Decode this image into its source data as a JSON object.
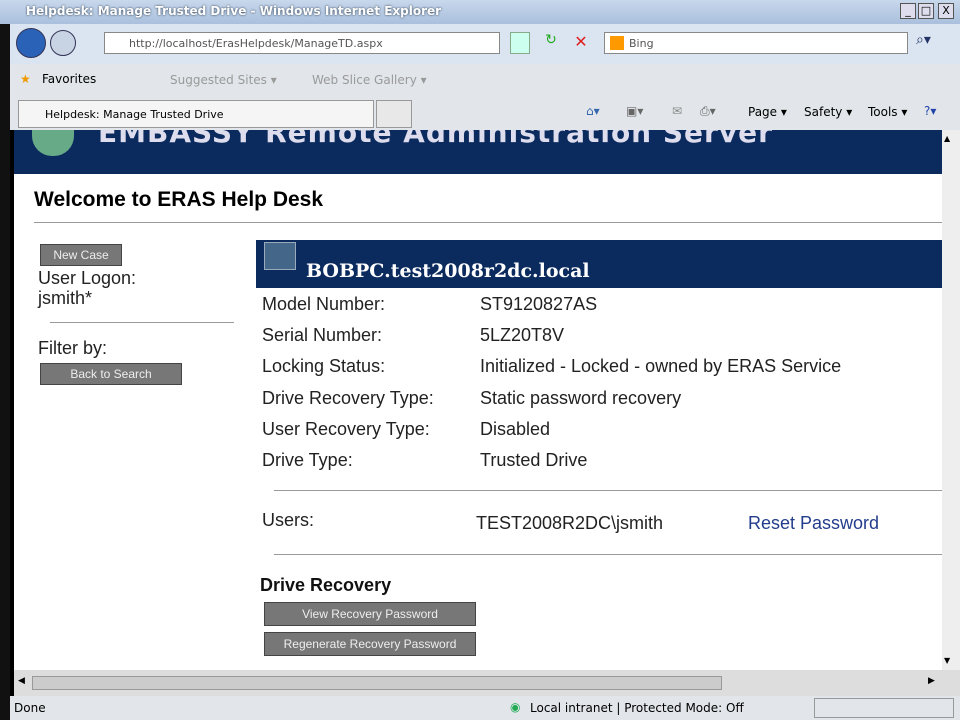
{
  "window": {
    "title": "Helpdesk: Manage Trusted Drive - Windows Internet Explorer",
    "min": "_",
    "max": "□",
    "close": "X"
  },
  "nav": {
    "url": "http://localhost/ErasHelpdesk/ManageTD.aspx",
    "search_placeholder": "Bing"
  },
  "favorites": {
    "label": "Favorites",
    "items": [
      "Suggested Sites ▾",
      "Web Slice Gallery ▾"
    ]
  },
  "tab": {
    "label": "Helpdesk: Manage Trusted Drive"
  },
  "commands": [
    "Page ▾",
    "Safety ▾",
    "Tools ▾"
  ],
  "banner": "EMBASSY  Remote Administration Server",
  "page_title": "Welcome to ERAS Help Desk",
  "sidebar": {
    "new_case": "New Case",
    "user_logon_label": "User Logon:",
    "user": "jsmith*",
    "filter_label": "Filter by:",
    "back": "Back to Search"
  },
  "device": {
    "name": "BOBPC.test2008r2dc.local",
    "fields": [
      {
        "label": "Model Number:",
        "value": "ST9120827AS"
      },
      {
        "label": "Serial Number:",
        "value": "5LZ20T8V"
      },
      {
        "label": "Locking Status:",
        "value": "Initialized - Locked - owned by ERAS Service"
      },
      {
        "label": "Drive Recovery Type:",
        "value": "Static password recovery"
      },
      {
        "label": "User Recovery Type:",
        "value": "Disabled"
      },
      {
        "label": "Drive Type:",
        "value": "Trusted Drive"
      }
    ]
  },
  "users": {
    "label": "Users:",
    "value": "TEST2008R2DC\\jsmith",
    "reset": "Reset Password"
  },
  "recovery": {
    "title": "Drive Recovery",
    "view": "View Recovery Password",
    "regen": "Regenerate Recovery Password"
  },
  "status": {
    "text": "Done",
    "zone": "Local intranet | Protected Mode: Off"
  }
}
